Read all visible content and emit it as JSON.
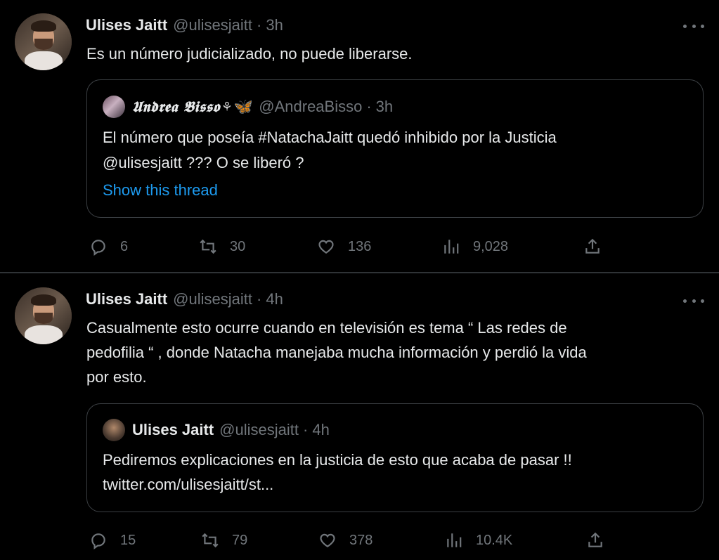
{
  "tweets": [
    {
      "author_name": "Ulises Jaitt",
      "handle": "@ulisesjaitt",
      "separator": "·",
      "time": "3h",
      "text": "Es un número judicializado, no puede liberarse.",
      "quote": {
        "author_name": "𝖀𝖓𝖉𝖗𝖊𝖆 𝕭𝖎𝖘𝖘𝖔",
        "handle": "@AndreaBisso",
        "separator": "·",
        "time": "3h",
        "text_line1": "El número que poseía #NatachaJaitt quedó inhibido por la Justicia",
        "text_line2": "@ulisesjaitt ??? O se liberó ?",
        "show_thread": "Show this thread"
      },
      "actions": {
        "replies": "6",
        "retweets": "30",
        "likes": "136",
        "views": "9,028"
      }
    },
    {
      "author_name": "Ulises Jaitt",
      "handle": "@ulisesjaitt",
      "separator": "·",
      "time": "4h",
      "text_line1": "Casualmente esto ocurre cuando en televisión es tema “ Las redes de",
      "text_line2": "pedofilia “ , donde Natacha manejaba mucha información y perdió la vida",
      "text_line3": "por esto.",
      "quote": {
        "author_name": "Ulises Jaitt",
        "handle": "@ulisesjaitt",
        "separator": "·",
        "time": "4h",
        "text_line1": "Pediremos explicaciones en la justicia de esto que acaba de pasar !!",
        "text_line2": "twitter.com/ulisesjaitt/st..."
      },
      "actions": {
        "replies": "15",
        "retweets": "79",
        "likes": "378",
        "views": "10.4K"
      }
    }
  ],
  "icons": {
    "reply": "reply-icon",
    "retweet": "retweet-icon",
    "like": "heart-icon",
    "views": "analytics-icon",
    "share": "share-icon",
    "more": "more-icon"
  },
  "colors": {
    "background": "#000000",
    "text": "#e7e9ea",
    "muted": "#71767b",
    "link": "#1d9bf0",
    "border": "#2f3336"
  }
}
